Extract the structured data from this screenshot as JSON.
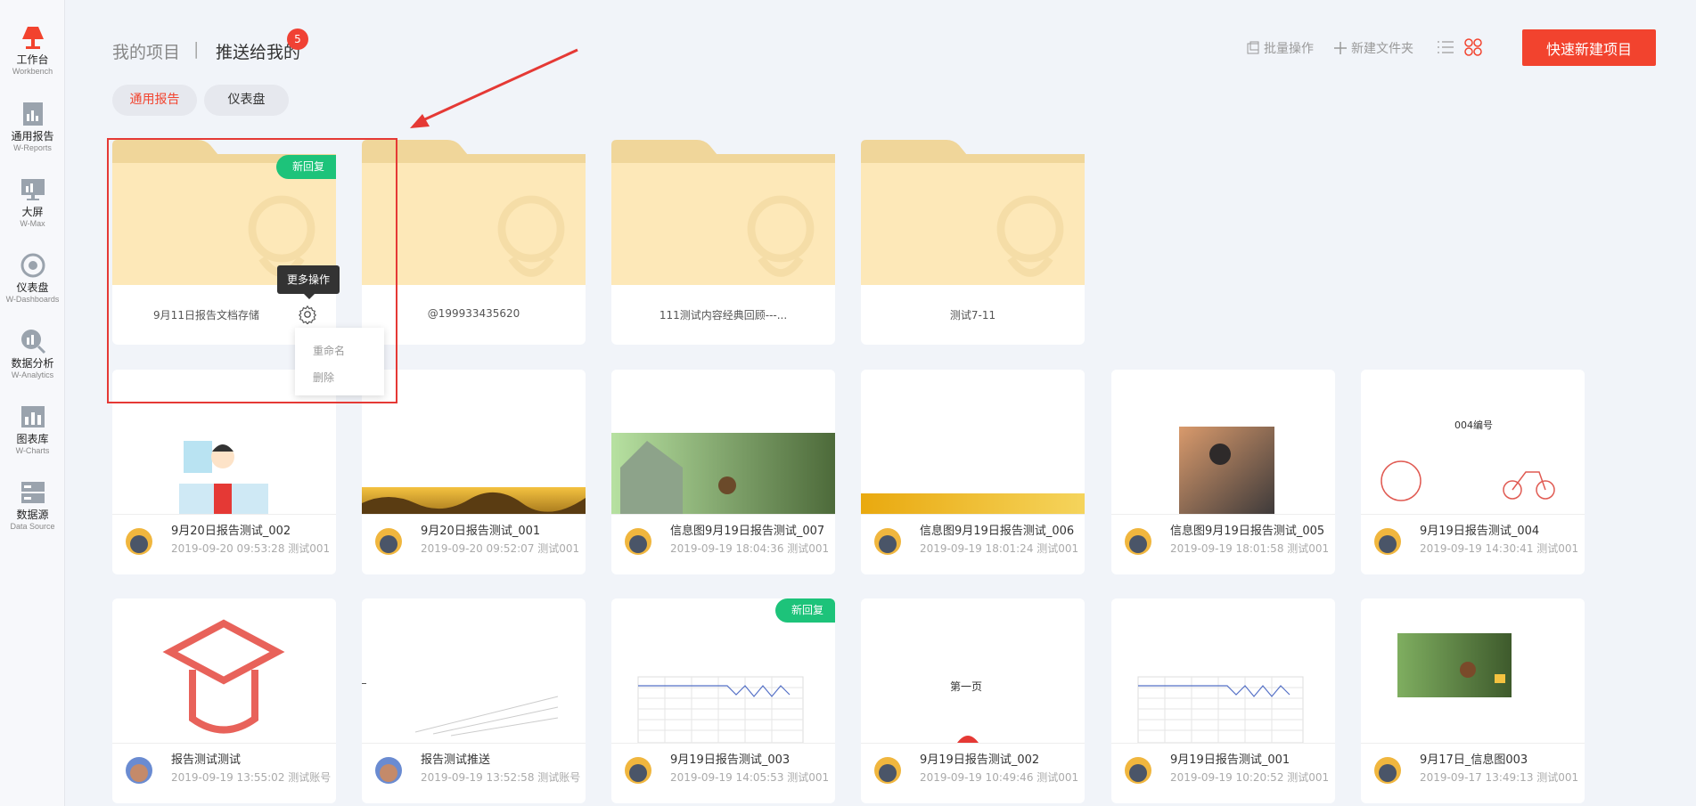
{
  "sidebar": {
    "items": [
      {
        "cn": "工作台",
        "en": "Workbench",
        "icon": "workbench-icon"
      },
      {
        "cn": "通用报告",
        "en": "W-Reports",
        "icon": "reports-icon"
      },
      {
        "cn": "大屏",
        "en": "W-Max",
        "icon": "bigscreen-icon"
      },
      {
        "cn": "仪表盘",
        "en": "W-Dashboards",
        "icon": "dashboard-icon"
      },
      {
        "cn": "数据分析",
        "en": "W-Analytics",
        "icon": "analytics-icon"
      },
      {
        "cn": "图表库",
        "en": "W-Charts",
        "icon": "charts-icon"
      },
      {
        "cn": "数据源",
        "en": "Data Source",
        "icon": "datasource-icon"
      }
    ]
  },
  "header": {
    "tab_mine": "我的项目",
    "separator": "|",
    "tab_pushed": "推送给我的",
    "badge": "5",
    "batch": "批量操作",
    "new_folder": "新建文件夹",
    "quick_new": "快速新建项目"
  },
  "filters": {
    "reports": "通用报告",
    "dashboard": "仪表盘"
  },
  "new_tag": "新回复",
  "folders": [
    {
      "name": "9月11日报告文档存储"
    },
    {
      "name": "@199933435620"
    },
    {
      "name": "111测试内容经典回顾---..."
    },
    {
      "name": "测试7-11"
    }
  ],
  "tooltip": "更多操作",
  "menu": {
    "rename": "重命名",
    "delete": "删除"
  },
  "cards_row1": [
    {
      "title": "9月20日报告测试_002",
      "meta": "2019-09-20 09:53:28 测试001"
    },
    {
      "title": "9月20日报告测试_001",
      "meta": "2019-09-20 09:52:07 测试001"
    },
    {
      "title": "信息图9月19日报告测试_007",
      "meta": "2019-09-19 18:04:36 测试001"
    },
    {
      "title": "信息图9月19日报告测试_006",
      "meta": "2019-09-19 18:01:24 测试001"
    },
    {
      "title": "信息图9月19日报告测试_005",
      "meta": "2019-09-19 18:01:58 测试001"
    },
    {
      "title": "9月19日报告测试_004",
      "meta": "2019-09-19 14:30:41 测试001",
      "thumb_text": "004编号"
    }
  ],
  "cards_row2": [
    {
      "title": "报告测试测试",
      "meta": "2019-09-19 13:55:02 测试账号"
    },
    {
      "title": "报告测试推送",
      "meta": "2019-09-19 13:52:58 测试账号"
    },
    {
      "title": "9月19日报告测试_003",
      "meta": "2019-09-19 14:05:53 测试001"
    },
    {
      "title": "9月19日报告测试_002",
      "meta": "2019-09-19 10:49:46 测试001",
      "thumb_text": "第一页"
    },
    {
      "title": "9月19日报告测试_001",
      "meta": "2019-09-19 10:20:52 测试001"
    },
    {
      "title": "9月17日_信息图003",
      "meta": "2019-09-17 13:49:13 测试001"
    }
  ]
}
